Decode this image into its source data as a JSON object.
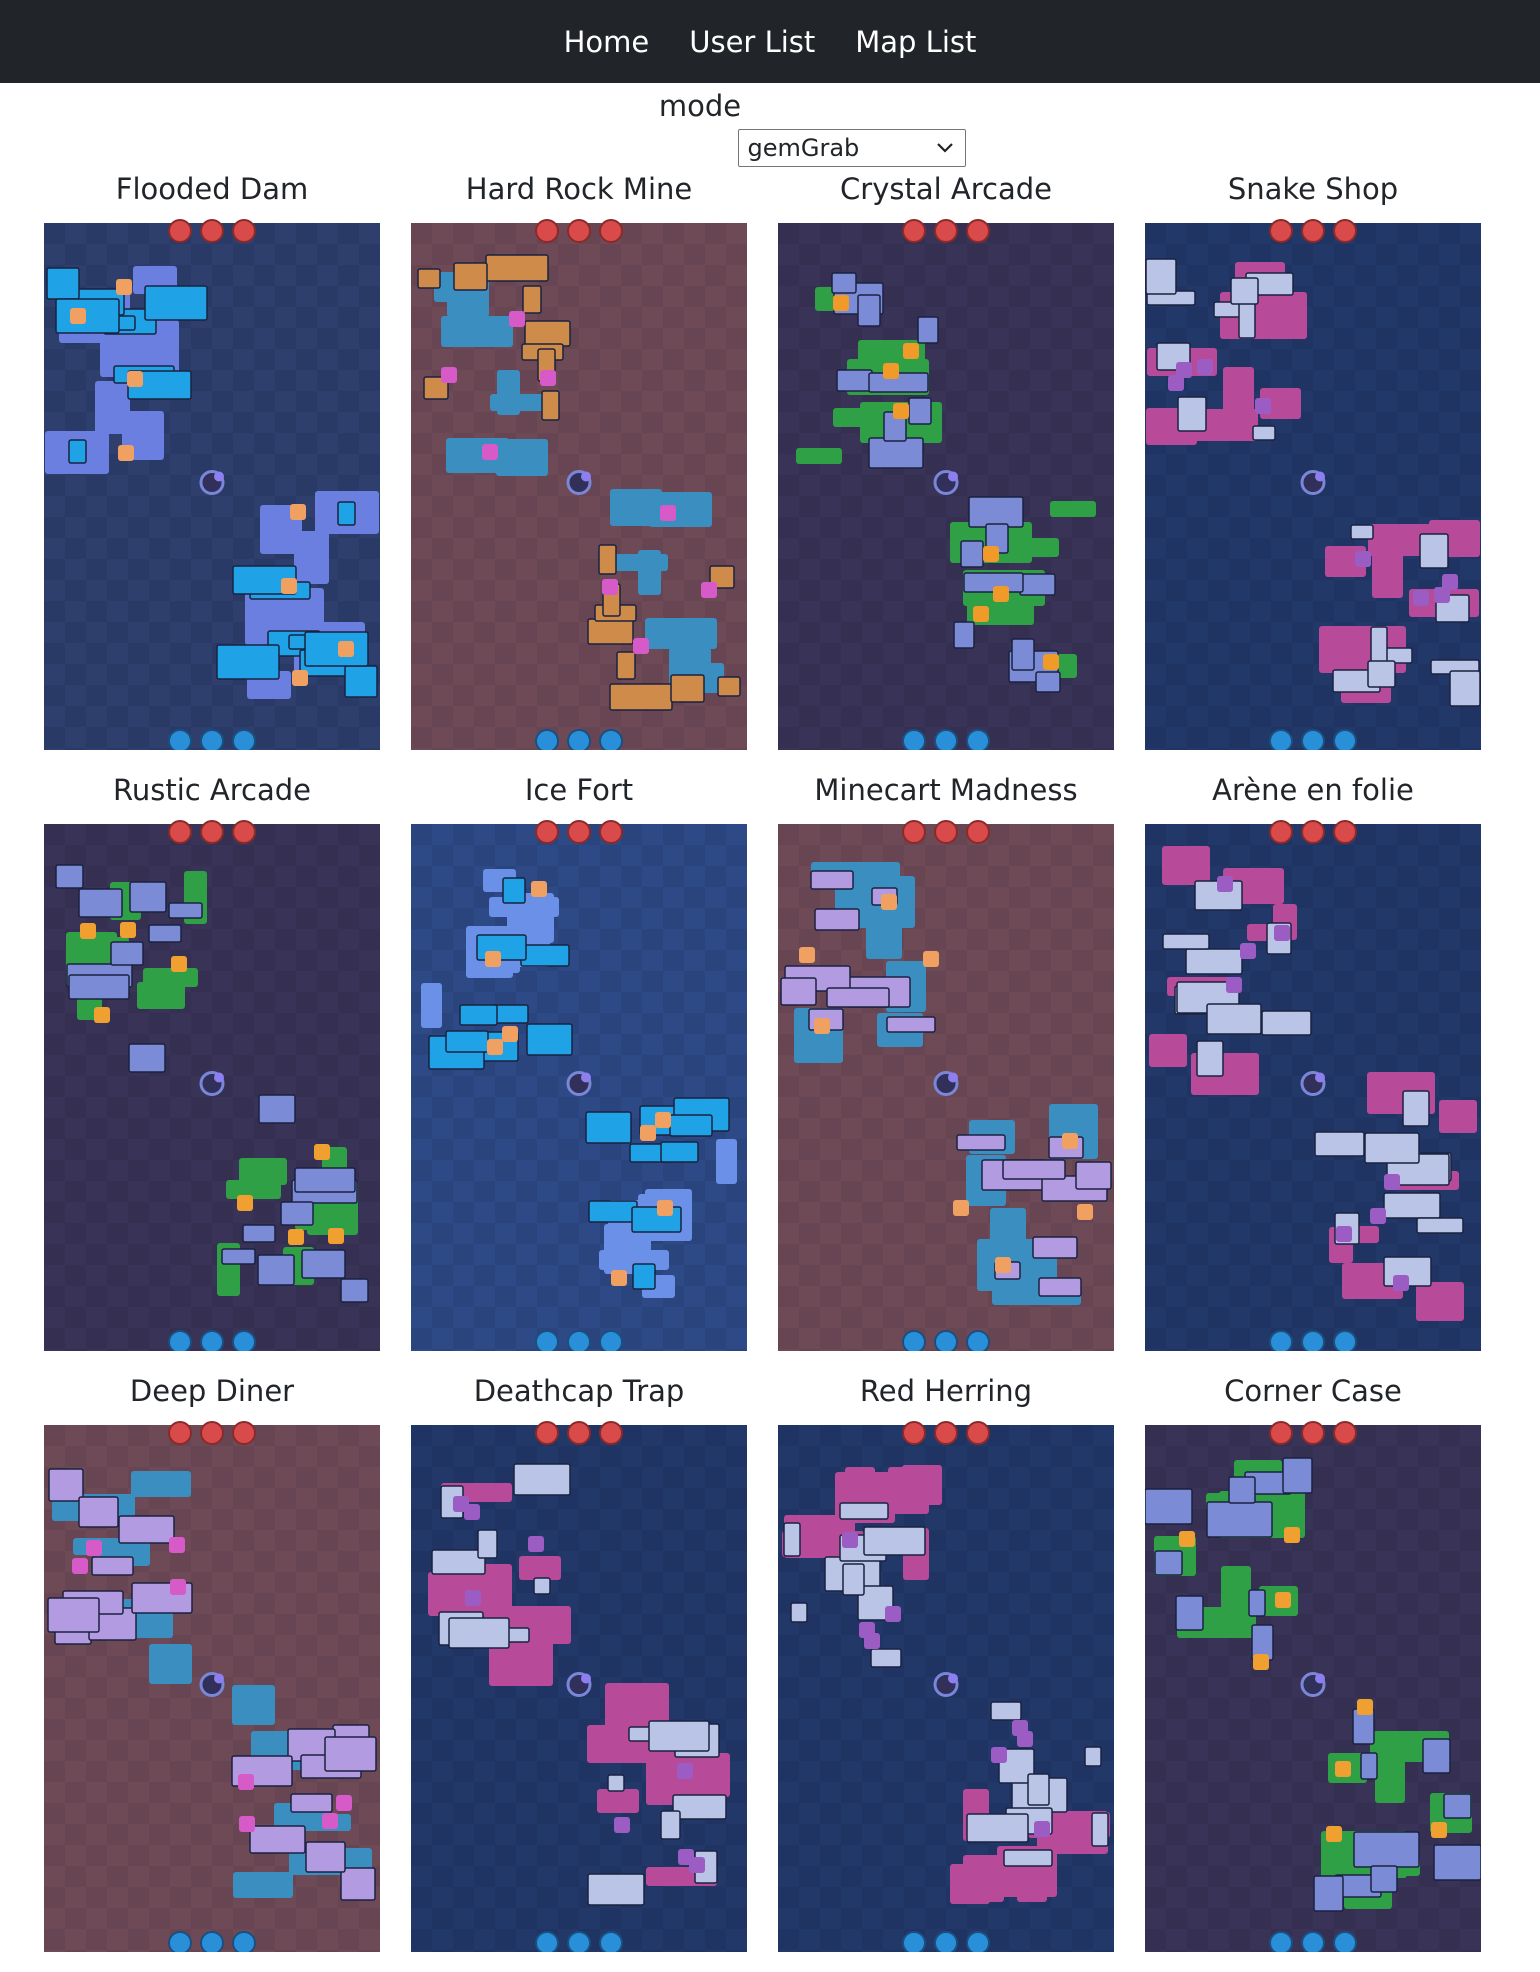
{
  "nav": {
    "items": [
      {
        "label": "Home"
      },
      {
        "label": "User List"
      },
      {
        "label": "Map List"
      }
    ]
  },
  "filter": {
    "label": "mode",
    "selected": "gemGrab",
    "chevron_icon": "chevron-down-icon"
  },
  "maps": [
    {
      "name": "Flooded Dam",
      "bg": "#2e3f6e",
      "tile": "#2a3a66",
      "wall": "#1fa3e6",
      "bush": "#6a7fe0",
      "accent": "#f0a060"
    },
    {
      "name": "Hard Rock Mine",
      "bg": "#6e4a57",
      "tile": "#684552",
      "wall": "#cf8b4a",
      "bush": "#3a8fc0",
      "accent": "#d65ac8"
    },
    {
      "name": "Crystal Arcade",
      "bg": "#3a3358",
      "tile": "#352f52",
      "wall": "#7c8bd6",
      "bush": "#2fa045",
      "accent": "#f09a2a"
    },
    {
      "name": "Snake Shop",
      "bg": "#223868",
      "tile": "#1f3462",
      "wall": "#b9c4e6",
      "bush": "#b84a9a",
      "accent": "#9b5cc4"
    },
    {
      "name": "Rustic Arcade",
      "bg": "#3a3358",
      "tile": "#352f52",
      "wall": "#7c8bd6",
      "bush": "#2fa045",
      "accent": "#f0a030"
    },
    {
      "name": "Ice Fort",
      "bg": "#2e4a86",
      "tile": "#2a457e",
      "wall": "#1fa3e6",
      "bush": "#6a90e8",
      "accent": "#f0a060"
    },
    {
      "name": "Minecart Madness",
      "bg": "#6e4a57",
      "tile": "#684552",
      "wall": "#b29be0",
      "bush": "#3a8fc0",
      "accent": "#f0a060"
    },
    {
      "name": "Arène en folie",
      "bg": "#223868",
      "tile": "#1f3462",
      "wall": "#b9c4e6",
      "bush": "#b84a9a",
      "accent": "#9b5cc4"
    },
    {
      "name": "Deep Diner",
      "bg": "#6e4a57",
      "tile": "#684552",
      "wall": "#b29be0",
      "bush": "#3a8fc0",
      "accent": "#d65ac8"
    },
    {
      "name": "Deathcap Trap",
      "bg": "#223868",
      "tile": "#1f3462",
      "wall": "#b9c4e6",
      "bush": "#b84a9a",
      "accent": "#9b5cc4"
    },
    {
      "name": "Red Herring",
      "bg": "#223868",
      "tile": "#1f3462",
      "wall": "#b9c4e6",
      "bush": "#b84a9a",
      "accent": "#9b5cc4"
    },
    {
      "name": "Corner Case",
      "bg": "#3a3358",
      "tile": "#352f52",
      "wall": "#7c8bd6",
      "bush": "#2fa045",
      "accent": "#f0a030"
    }
  ],
  "colors": {
    "navbar": "#212529",
    "red_spawn": "#d94a4a",
    "blue_spawn": "#2a8fd9"
  }
}
